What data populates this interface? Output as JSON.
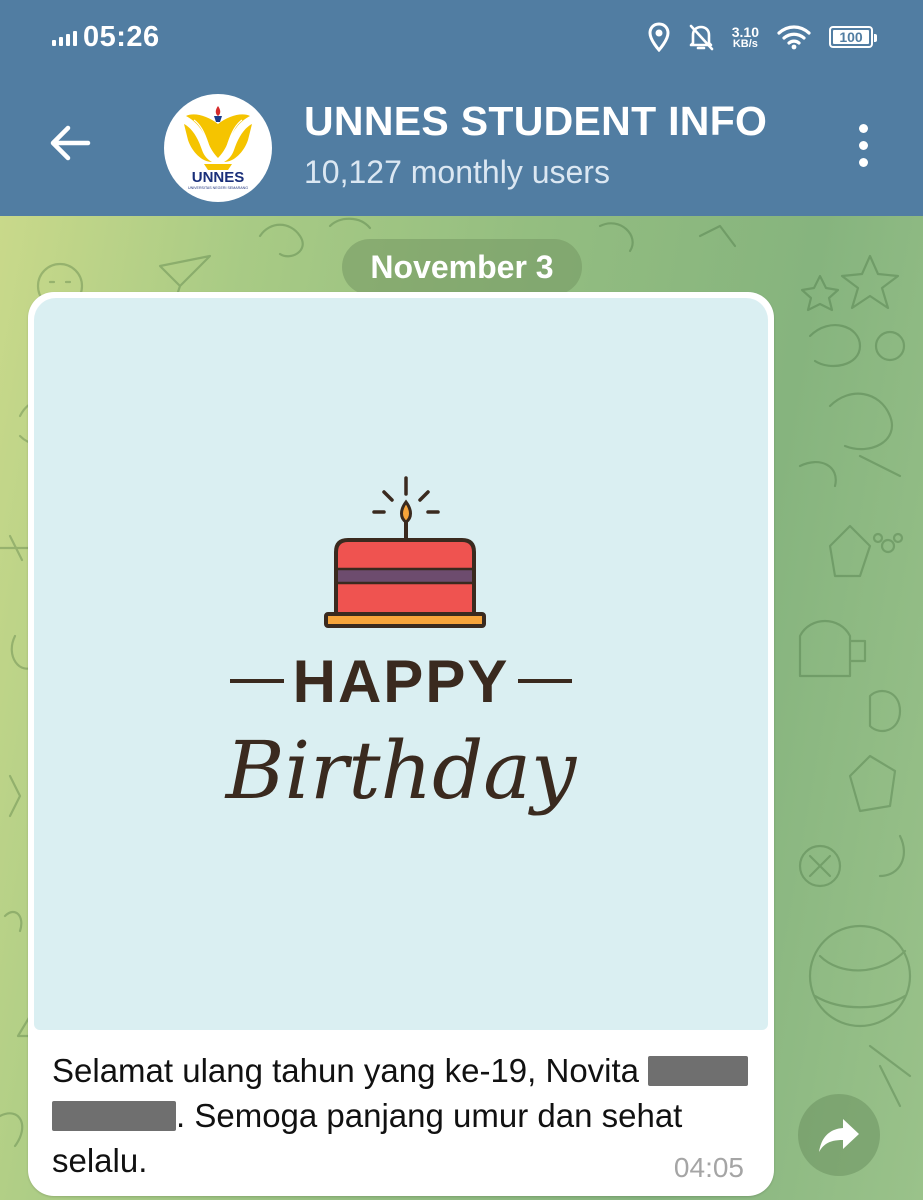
{
  "status_bar": {
    "time": "05:26",
    "net_speed_value": "3.10",
    "net_speed_unit": "KB/s",
    "battery_level": "100",
    "icons": [
      "signal-icon",
      "location-icon",
      "bell-off-icon",
      "wifi-icon",
      "battery-icon"
    ]
  },
  "header": {
    "title": "UNNES STUDENT INFO",
    "subtitle": "10,127 monthly users",
    "avatar_logo_text": "UNNES",
    "avatar_logo_subtext": "UNIVERSITAS NEGERI SEMARANG",
    "colors": {
      "background": "#517da2",
      "text": "#ffffff"
    }
  },
  "chat": {
    "date_label": "November 3",
    "message": {
      "image": {
        "happy_text": "HAPPY",
        "birthday_text": "Birthday",
        "colors": {
          "background": "#daeff2",
          "cake": "#ef5350",
          "stripe": "#6d4c6e",
          "plate": "#f7a43a",
          "ink": "#3a2a1f"
        }
      },
      "caption_part1": "Selamat ulang tahun yang ke-19, Novita ",
      "caption_part2": ". Semoga panjang umur dan sehat selalu.",
      "time": "04:05"
    }
  }
}
